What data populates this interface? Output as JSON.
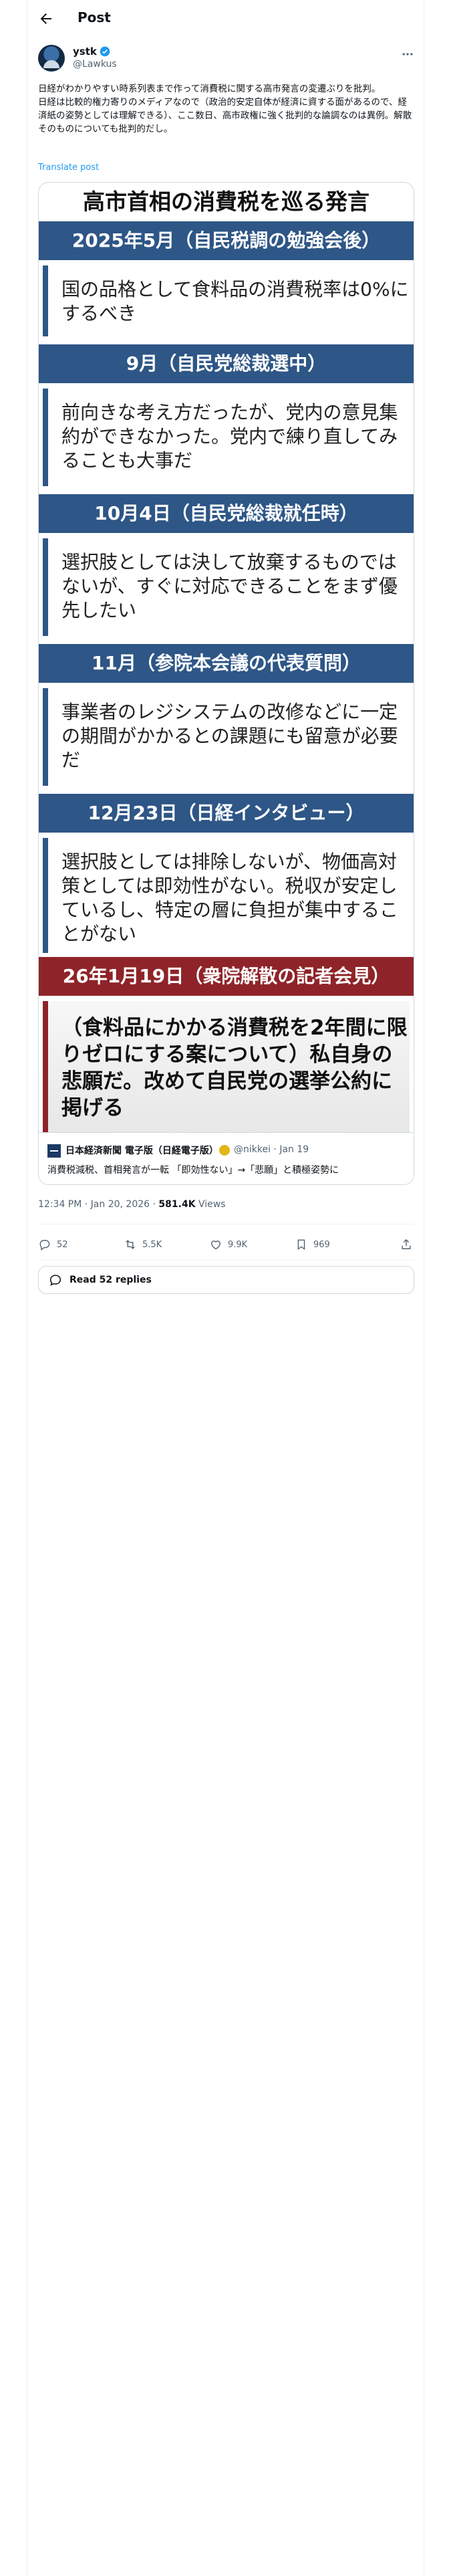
{
  "header": {
    "title": "Post"
  },
  "author": {
    "name": "ystk",
    "handle": "@Lawkus"
  },
  "tweet": {
    "text": "日経がわかりやすい時系列表まで作って消費税に関する高市発言の変遷ぶりを批判。\n日経は比較的権力寄りのメディアなので（政治的安定自体が経済に資する面があるので、経済紙の姿勢としては理解できる）、ここ数日、高市政権に強く批判的な論調なのは異例。解散そのものについても批判的だし。",
    "translate": "Translate post"
  },
  "infographic": {
    "title": "高市首相の消費税を巡る発言",
    "sections": [
      {
        "head": "2025年5月（自民税調の勉強会後）",
        "body": "国の品格として食料品の消費税率は0%にするべき"
      },
      {
        "head": "9月（自民党総裁選中）",
        "body": "前向きな考え方だったが、党内の意見集約ができなかった。党内で練り直してみることも大事だ"
      },
      {
        "head": "10月4日（自民党総裁就任時）",
        "body": "選択肢としては決して放棄するものではないが、すぐに対応できることをまず優先したい"
      },
      {
        "head": "11月（参院本会議の代表質問）",
        "body": "事業者のレジシステムの改修などに一定の期間がかかるとの課題にも留意が必要だ"
      },
      {
        "head": "12月23日（日経インタビュー）",
        "body": "選択肢としては排除しないが、物価高対策としては即効性がない。税収が安定しているし、特定の層に負担が集中することがない"
      },
      {
        "head": "26年1月19日（衆院解散の記者会見）",
        "body": "（食料品にかかる消費税を2年間に限りゼロにする案について）私自身の悲願だ。改めて自民党の選挙公約に掲げる"
      }
    ]
  },
  "embed": {
    "source_name": "日本経済新聞 電子版（日経電子版）",
    "source_handle": "@nikkei · Jan 19",
    "headline": "消費税減税、首相発言が一転 「即効性ない」→「悲願」と積極姿勢に"
  },
  "meta": {
    "time": "12:34 PM · Jan 20, 2026 · ",
    "views_count": "581.4K",
    "views_label": " Views"
  },
  "actions": {
    "replies": "52",
    "reposts": "5.5K",
    "likes": "9.9K",
    "bookmarks": "969"
  },
  "read_replies": "Read 52 replies",
  "icons": [
    "back-arrow-icon",
    "verified-icon",
    "more-icon",
    "reply-icon",
    "repost-icon",
    "like-icon",
    "bookmark-icon",
    "share-icon",
    "speech-bubble-icon"
  ],
  "colors": {
    "section_blue": "#2e5686",
    "section_red": "#8e2429",
    "link": "#1d9bf0",
    "verified": "#1d9bf0"
  }
}
